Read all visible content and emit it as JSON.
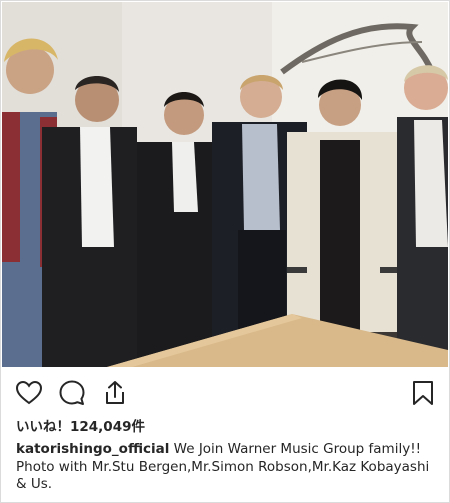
{
  "post": {
    "likes_label": "いいね！124,049件",
    "username": "katorishingo_official",
    "caption": " We Join Warner Music Group family!! Photo with Mr.Stu Bergen,Mr.Simon Robson,Mr.Kaz Kobayashi & Us."
  },
  "icons": {
    "like": "heart-icon",
    "comment": "comment-icon",
    "share": "share-icon",
    "save": "bookmark-icon"
  },
  "colors": {
    "text": "#262626",
    "border": "#dbdbdb"
  }
}
